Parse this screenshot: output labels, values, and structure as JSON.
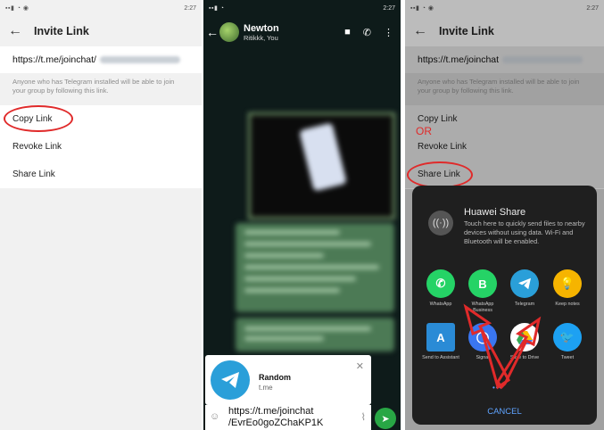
{
  "left_screen": {
    "status_time": "2:27",
    "title": "Invite Link",
    "link_text": "https://t.me/joinchat/",
    "hint": "Anyone who has Telegram installed will be able to join your group by following this link.",
    "menu": [
      "Copy Link",
      "Revoke Link",
      "Share Link"
    ]
  },
  "chat_screen": {
    "status_time": "2:27",
    "name": "Newton",
    "members": "Ritikkk, You",
    "preview_title": "Random",
    "preview_domain": "t.me",
    "input_line1": "https://t.me/joinchat",
    "input_line2": "/EvrEo0goZChaKP1K"
  },
  "right_screen": {
    "status_time": "2:27",
    "title": "Invite Link",
    "link_text": "https://t.me/joinchat",
    "hint": "Anyone who has Telegram installed will be able to join your group by following this link.",
    "menu": [
      "Copy Link",
      "Revoke Link",
      "Share Link"
    ],
    "or_label": "OR",
    "share_sheet": {
      "title": "Huawei Share",
      "desc": "Touch here to quickly send files to nearby devices without using data. Wi-Fi and Bluetooth will be enabled.",
      "apps": [
        {
          "label": "WhatsApp",
          "color": "#25d366",
          "icon": "whatsapp-icon"
        },
        {
          "label": "WhatsApp Business",
          "color": "#25d366",
          "icon": "whatsapp-business-icon"
        },
        {
          "label": "Telegram",
          "color": "#2a9fd9",
          "icon": "telegram-icon"
        },
        {
          "label": "Keep notes",
          "color": "#f6b400",
          "icon": "keep-notes-icon"
        },
        {
          "label": "Send to Assistant",
          "color": "#2a8bd6",
          "icon": "assistant-icon"
        },
        {
          "label": "Signal",
          "color": "#3a76f0",
          "icon": "signal-icon"
        },
        {
          "label": "Save to Drive",
          "color": "#ffffff",
          "icon": "drive-icon"
        },
        {
          "label": "Tweet",
          "color": "#1da1f2",
          "icon": "twitter-icon"
        }
      ],
      "cancel": "CANCEL"
    }
  },
  "accent": "#e02a2a"
}
